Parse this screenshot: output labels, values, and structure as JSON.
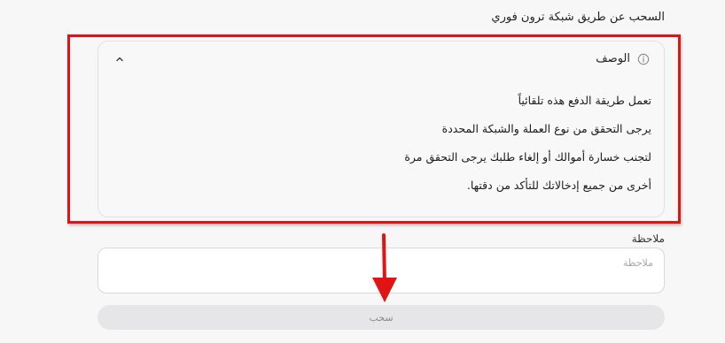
{
  "section": {
    "title": "السحب عن طريق شبكة ترون فوري"
  },
  "description": {
    "title": "الوصف",
    "lines": [
      "تعمل طريقة الدفع هذه تلقائياً",
      "يرجى التحقق من نوع العملة والشبكة المحددة",
      "لتجنب خسارة أموالك أو إلغاء طلبك يرجى التحقق مرة",
      "أخرى من جميع إدخالاتك للتأكد من دقتها."
    ],
    "info_icon": "info-circle-icon",
    "toggle_icon": "chevron-up-icon"
  },
  "note": {
    "label": "ملاحظة",
    "placeholder": "ملاحظة",
    "value": ""
  },
  "withdraw": {
    "label": "سحب"
  },
  "annotation": {
    "highlight_color": "#e11414",
    "arrow_color": "#e11414"
  }
}
